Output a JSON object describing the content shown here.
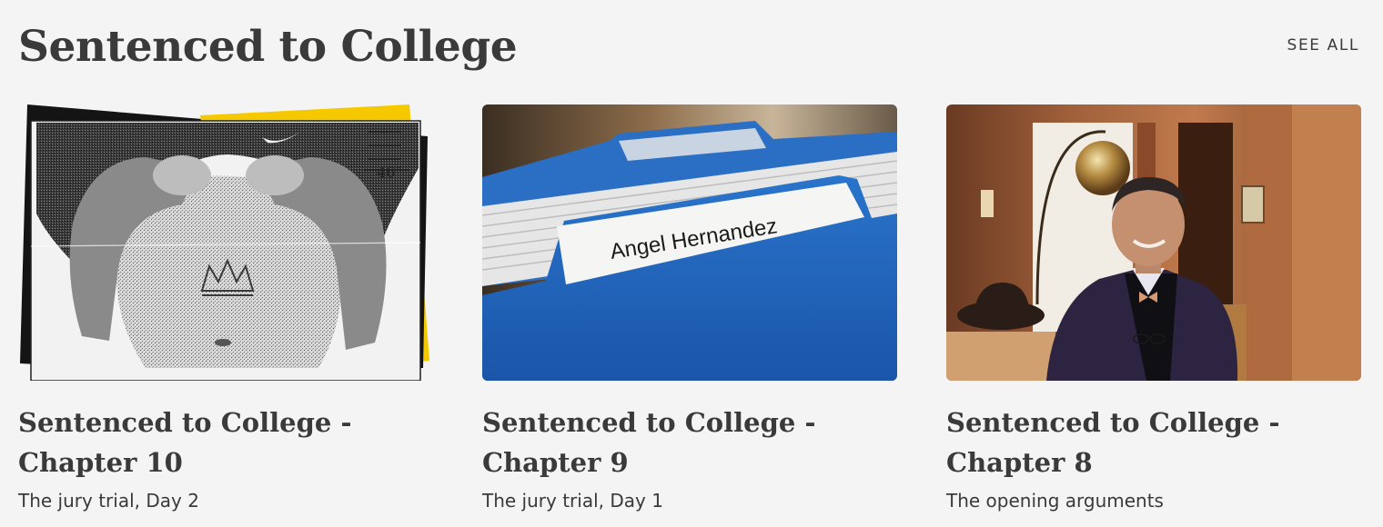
{
  "section": {
    "title": "Sentenced to College",
    "see_all_label": "SEE ALL"
  },
  "cards": [
    {
      "title_line1": "Sentenced to College -",
      "title_line2": "Chapter 10",
      "subtitle": "The jury trial, Day 2",
      "image": {
        "kind": "photocopied evidence photo of torso with crown tattoo",
        "ruler_mark": "46\""
      }
    },
    {
      "title_line1": "Sentenced to College -",
      "title_line2": "Chapter 9",
      "subtitle": "The jury trial, Day 1",
      "image": {
        "kind": "blue file folder",
        "folder_label": "Angel Hernandez"
      }
    },
    {
      "title_line1": "Sentenced to College -",
      "title_line2": "Chapter 8",
      "subtitle": "The opening arguments",
      "image": {
        "kind": "portrait of smiling man in bow tie seated in wood-paneled room"
      }
    }
  ],
  "colors": {
    "background": "#f4f4f4",
    "text": "#3a3a3a",
    "accent_yellow": "#f5c800",
    "folder_blue": "#1f63b8"
  }
}
